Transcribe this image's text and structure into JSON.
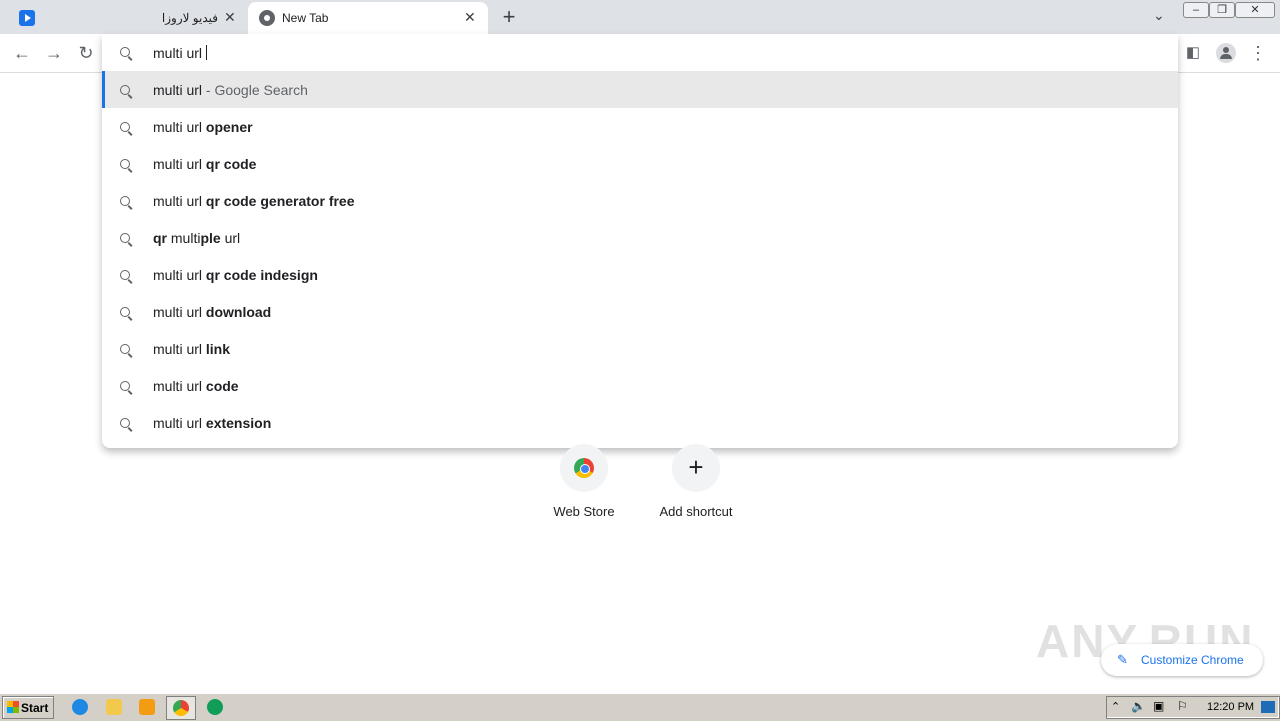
{
  "tabs": [
    {
      "title": "فيديو لاروزا",
      "icon": "video-player-icon"
    },
    {
      "title": "New Tab",
      "icon": "chrome-icon"
    }
  ],
  "omnibox": {
    "typed": "multi url",
    "suggestions": [
      {
        "prefix": "multi url",
        "rest": "",
        "suffix": "Google Search",
        "selected": true
      },
      {
        "prefix": "multi url",
        "rest": "opener"
      },
      {
        "prefix": "multi url",
        "rest": "qr code"
      },
      {
        "prefix": "multi url",
        "rest": "qr code generator free"
      },
      {
        "prefix": "",
        "rest": "qr multiple url",
        "mixed": true
      },
      {
        "prefix": "multi url",
        "rest": "qr code indesign"
      },
      {
        "prefix": "multi url",
        "rest": "download"
      },
      {
        "prefix": "multi url",
        "rest": "link"
      },
      {
        "prefix": "multi url",
        "rest": "code"
      },
      {
        "prefix": "multi url",
        "rest": "extension"
      }
    ]
  },
  "shortcuts": [
    {
      "label": "Web Store",
      "icon": "webstore-icon"
    },
    {
      "label": "Add shortcut",
      "icon": "plus-icon"
    }
  ],
  "customize_label": "Customize Chrome",
  "watermark": "ANY.RUN",
  "taskbar": {
    "start_label": "Start",
    "clock": "12:20 PM"
  },
  "colors": {
    "accent": "#1a73e8",
    "tabstrip": "#dee1e6",
    "selected_row": "#e8e8e9"
  }
}
